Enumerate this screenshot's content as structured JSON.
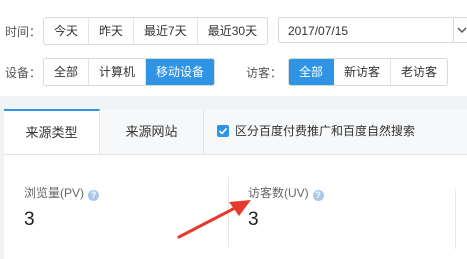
{
  "filters": {
    "time_label": "时间：",
    "time_options": [
      "今天",
      "昨天",
      "最近7天",
      "最近30天"
    ],
    "date_value": "2017/07/15",
    "device_label": "设备：",
    "device_options": [
      "全部",
      "计算机",
      "移动设备"
    ],
    "device_active": "移动设备",
    "visitor_label": "访客：",
    "visitor_options": [
      "全部",
      "新访客",
      "老访客"
    ],
    "visitor_active": "全部"
  },
  "tabs": {
    "source_type": "来源类型",
    "source_site": "来源网站",
    "checkbox_label": "区分百度付费推广和百度自然搜索",
    "checkbox_checked": true
  },
  "metrics": {
    "pv_label": "浏览量(PV)",
    "pv_value": "3",
    "uv_label": "访客数(UV)",
    "uv_value": "3"
  },
  "colors": {
    "accent": "#2f94e6",
    "annotation_arrow": "#e8392f"
  },
  "icons": {
    "help": "help-icon",
    "dropdown": "chevron-down-icon",
    "check": "check-icon",
    "annotation": "red-arrow-icon"
  }
}
